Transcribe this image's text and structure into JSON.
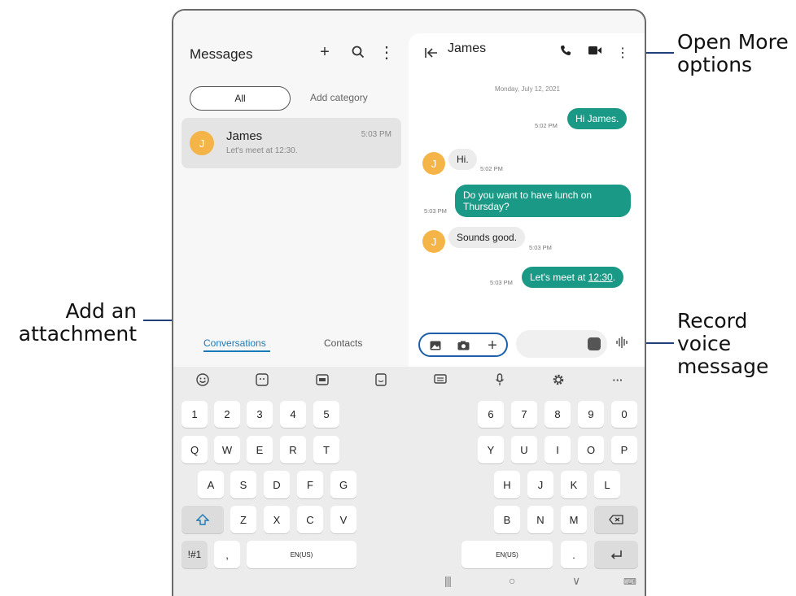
{
  "callouts": {
    "open_more": [
      "Open More",
      "options"
    ],
    "add_attachment": [
      "Add an",
      "attachment"
    ],
    "record_voice": [
      "Record",
      "voice",
      "message"
    ]
  },
  "left_pane": {
    "title": "Messages",
    "icons": {
      "add": "+",
      "search": "⌕",
      "more": "⋮"
    },
    "filters": {
      "all": "All",
      "add_category": "Add category"
    },
    "conversation": {
      "avatar_initial": "J",
      "name": "James",
      "preview": "Let's meet at 12:30.",
      "time": "5:03 PM"
    },
    "tabs": {
      "conversations": "Conversations",
      "contacts": "Contacts"
    }
  },
  "chat": {
    "contact_name": "James",
    "date": "Monday, July 12, 2021",
    "messages": [
      {
        "dir": "out",
        "text": "Hi James.",
        "time": "5:02 PM"
      },
      {
        "dir": "in",
        "text": "Hi.",
        "time": "5:02 PM",
        "avatar": "J"
      },
      {
        "dir": "out",
        "text_line1": "Do you want to have lunch on",
        "text_line2": "Thursday?",
        "time": "5:03 PM"
      },
      {
        "dir": "in",
        "text": "Sounds good.",
        "time": "5:03 PM",
        "avatar": "J"
      },
      {
        "dir": "out",
        "text_prefix": "Let's meet at ",
        "text_link": "12:30",
        "text_suffix": ".",
        "time": "5:03 PM"
      }
    ],
    "attach_plus": "+"
  },
  "keyboard": {
    "toolbar_more": "···",
    "rows": {
      "numbers_left": [
        "1",
        "2",
        "3",
        "4",
        "5"
      ],
      "numbers_right": [
        "6",
        "7",
        "8",
        "9",
        "0"
      ],
      "row1_left": [
        "Q",
        "W",
        "E",
        "R",
        "T"
      ],
      "row1_right": [
        "Y",
        "U",
        "I",
        "O",
        "P"
      ],
      "row2_left": [
        "A",
        "S",
        "D",
        "F",
        "G"
      ],
      "row2_right": [
        "H",
        "J",
        "K",
        "L"
      ],
      "row3_left": [
        "Z",
        "X",
        "C",
        "V"
      ],
      "row3_right": [
        "B",
        "N",
        "M"
      ]
    },
    "shift": "⇧",
    "backspace": "⌫",
    "symbols": "!#1",
    "comma": ",",
    "space_left": "EN(US)",
    "space_right": "EN(US)",
    "period": ".",
    "enter": "↵"
  },
  "navbar": {
    "recents": "|||",
    "home": "○",
    "back": "∨",
    "keyboard": "⌨"
  },
  "colors": {
    "accent_teal": "#1a9a86",
    "callout_blue": "#1f3f7a",
    "avatar": "#f5b447",
    "tab_blue": "#1a7ab8"
  }
}
